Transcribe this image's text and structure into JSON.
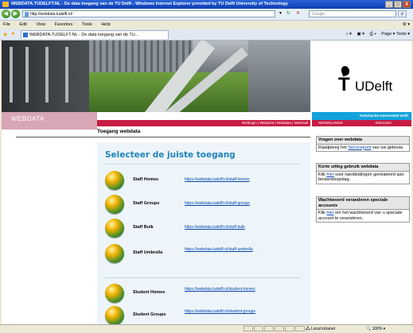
{
  "window": {
    "title": "WEBDATA.TUDELFT.NL - De data toegang van de TU Delft - Windows Internet Explorer provided by TU Delft University of Technology",
    "controls": {
      "minimize": "_",
      "maximize": "□",
      "close": "X"
    }
  },
  "browser": {
    "address": "http://webdata.tudelft.nl/",
    "search_placeholder": "Google",
    "menu": [
      "File",
      "Edit",
      "View",
      "Favorites",
      "Tools",
      "Help"
    ],
    "tab_title": "WEBDATA.TUDELFT.NL - De data toegang van de TU...",
    "commands": "Page ▾   Tools ▾"
  },
  "header": {
    "site_label": "WEBDATA",
    "nav_links": "Weblogin | Webprint | Webdata | Webmail",
    "logo_t": "T",
    "logo_delft": "UDelft",
    "tagline": "Technische Universiteit Delft",
    "lang_nl": "NEDERLANDS",
    "lang_en": "ENGLISH"
  },
  "main": {
    "page_title": "Toegang webdata",
    "panel_title": "Selecteer de juiste toegang",
    "items": [
      {
        "name": "Staff Homes",
        "url": "https://webdata.tudelft.nl/staff-homes"
      },
      {
        "name": "Staff Groups",
        "url": "https://webdata.tudelft.nl/staff-groups"
      },
      {
        "name": "Staff Bulk",
        "url": "https://webdata.tudelft.nl/staff-bulk"
      },
      {
        "name": "Staff Umbrella",
        "url": "https://webdata.tudelft.nl/staff-umbrella"
      },
      {
        "name": "Student Homes",
        "url": "https://webdata.tudelft.nl/student-homes"
      },
      {
        "name": "Student Groups",
        "url": "https://webdata.tudelft.nl/student-groups"
      }
    ]
  },
  "sidebar": {
    "box1": {
      "title": "Vragen over webdata",
      "text_pre": "Raadpleeg het ",
      "link": "Servicepunt",
      "text_post": " van uw gebouw."
    },
    "box2": {
      "title": "Korte uitleg gebruik webdata",
      "text_pre": "Klik ",
      "link": "hier",
      "text_post": " voor handleidingen gerelateerd aan bestandsopslag."
    },
    "box3": {
      "title": "Wachtwoord veranderen speciale accounts",
      "text_pre": "Klik ",
      "link": "hier",
      "text_post": " om het wachtwoord van u speciale account te veranderen."
    }
  },
  "statusbar": {
    "zone": "Local intranet",
    "zoom": "100%"
  }
}
